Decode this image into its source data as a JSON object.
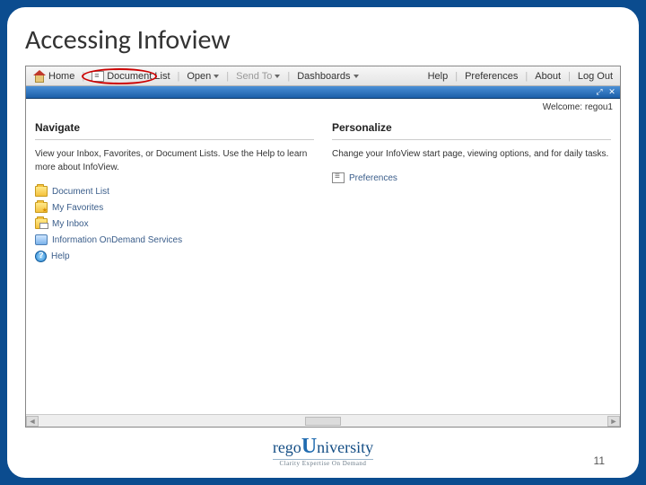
{
  "slide": {
    "title": "Accessing Infoview",
    "page_number": "11"
  },
  "toolbar": {
    "home": "Home",
    "document_list": "Document List",
    "open": "Open",
    "send_to": "Send To",
    "dashboards": "Dashboards",
    "help": "Help",
    "preferences": "Preferences",
    "about": "About",
    "logout": "Log Out"
  },
  "welcome": {
    "label": "Welcome:",
    "user": "regou1"
  },
  "navigate": {
    "heading": "Navigate",
    "desc": "View your Inbox, Favorites, or Document Lists. Use the Help to learn more about InfoView.",
    "links": {
      "document_list": "Document List",
      "my_favorites": "My Favorites",
      "my_inbox": "My Inbox",
      "info_ondemand": "Information OnDemand Services",
      "help": "Help"
    }
  },
  "personalize": {
    "heading": "Personalize",
    "desc": "Change your InfoView start page, viewing options, and for daily tasks.",
    "links": {
      "preferences": "Preferences"
    }
  },
  "logo": {
    "brand_a": "rego",
    "brand_b": "niversity",
    "tagline": "Clarity Expertise On Demand"
  }
}
